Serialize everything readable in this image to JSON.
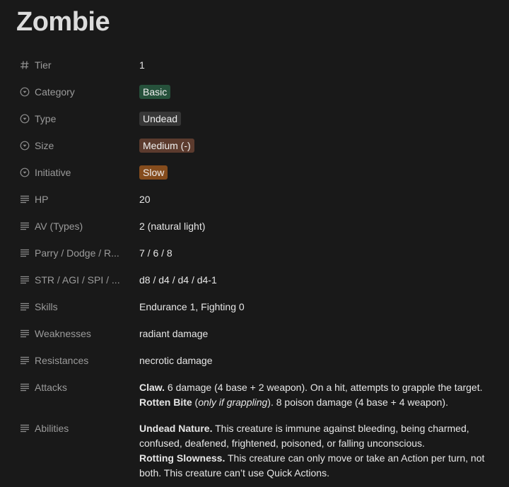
{
  "title": "Zombie",
  "properties": {
    "tier": {
      "label": "Tier",
      "value": "1"
    },
    "category": {
      "label": "Category",
      "value": "Basic",
      "color": "#26513b"
    },
    "type": {
      "label": "Type",
      "value": "Undead",
      "color": "#373737"
    },
    "size": {
      "label": "Size",
      "value": "Medium (-)",
      "color": "#5c3b2e"
    },
    "initiative": {
      "label": "Initiative",
      "value": "Slow",
      "color": "#854c1d"
    },
    "hp": {
      "label": "HP",
      "value": "20"
    },
    "av": {
      "label": "AV (Types)",
      "value": "2 (natural light)"
    },
    "parry": {
      "label": "Parry / Dodge / R...",
      "value": "7 / 6 / 8"
    },
    "stats": {
      "label": "STR / AGI / SPI / ...",
      "value": "d8 / d4 / d4 / d4-1"
    },
    "skills": {
      "label": "Skills",
      "value": "Endurance 1, Fighting 0"
    },
    "weaknesses": {
      "label": "Weaknesses",
      "value": "radiant damage"
    },
    "resistances": {
      "label": "Resistances",
      "value": "necrotic damage"
    },
    "attacks": {
      "label": "Attacks",
      "claw_name": "Claw.",
      "claw_text": " 6 damage (4 base + 2 weapon). On a hit, attempts to grapple the target.",
      "bite_name": "Rotten Bite",
      "bite_open": " (",
      "bite_condition": "only if grappling",
      "bite_text": "). 8 poison damage (4 base + 4 weapon)."
    },
    "abilities": {
      "label": "Abilities",
      "undead_name": "Undead Nature.",
      "undead_text": " This creature is immune against bleeding, being charmed, confused, deafened, frightened, poisoned, or falling unconscious.",
      "rotting_name": "Rotting Slowness.",
      "rotting_text": " This creature can only move or take an Action per turn, not both. This creature can’t use Quick Actions."
    }
  },
  "icons": {
    "number": "hash-icon",
    "select": "select-icon",
    "text": "text-lines-icon"
  }
}
